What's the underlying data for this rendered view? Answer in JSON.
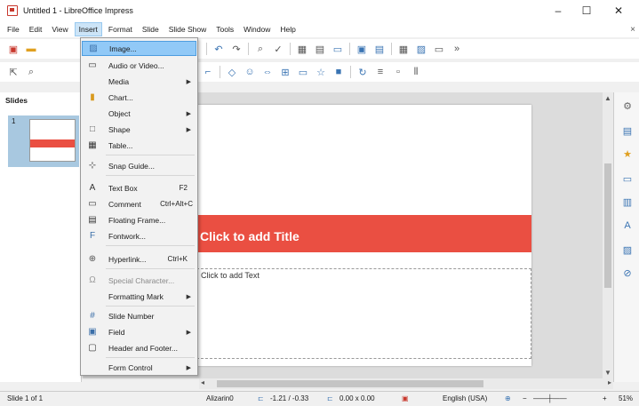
{
  "window": {
    "title": "Untitled 1 - LibreOffice Impress",
    "minimize": "–",
    "maximize": "☐",
    "close": "✕"
  },
  "menubar": {
    "items": [
      "File",
      "Edit",
      "View",
      "Insert",
      "Format",
      "Slide",
      "Slide Show",
      "Tools",
      "Window",
      "Help"
    ],
    "close_doc": "×"
  },
  "slides_panel": {
    "header": "Slides",
    "slide_number": "1"
  },
  "slide": {
    "title_placeholder": "Click to add Title",
    "text_placeholder": "Click to add Text"
  },
  "insert_menu": {
    "image": {
      "label": "Image...",
      "icon": "image-icon"
    },
    "audio_video": {
      "label": "Audio or Video...",
      "icon": "media-icon"
    },
    "media": {
      "label": "Media"
    },
    "chart": {
      "label": "Chart...",
      "icon": "chart-icon"
    },
    "object": {
      "label": "Object"
    },
    "shape": {
      "label": "Shape",
      "icon": "shape-icon"
    },
    "table": {
      "label": "Table...",
      "icon": "table-icon"
    },
    "snap_guide": {
      "label": "Snap Guide...",
      "icon": "snap-guide-icon"
    },
    "text_box": {
      "label": "Text Box",
      "shortcut": "F2",
      "icon": "text-box-icon"
    },
    "comment": {
      "label": "Comment",
      "shortcut": "Ctrl+Alt+C",
      "icon": "comment-icon"
    },
    "floating_frame": {
      "label": "Floating Frame...",
      "icon": "floating-frame-icon"
    },
    "fontwork": {
      "label": "Fontwork...",
      "icon": "fontwork-icon"
    },
    "hyperlink": {
      "label": "Hyperlink...",
      "shortcut": "Ctrl+K",
      "icon": "hyperlink-icon"
    },
    "special_character": {
      "label": "Special Character...",
      "icon": "omega-icon"
    },
    "formatting_mark": {
      "label": "Formatting Mark"
    },
    "slide_number": {
      "label": "Slide Number",
      "icon": "hash-icon"
    },
    "field": {
      "label": "Field",
      "icon": "field-icon"
    },
    "header_footer": {
      "label": "Header and Footer...",
      "icon": "header-footer-icon"
    },
    "form_control": {
      "label": "Form Control"
    }
  },
  "statusbar": {
    "slide_info": "Slide 1 of 1",
    "master": "Alizarin0",
    "position": "-1.21 / -0.33",
    "size": "0.00 x 0.00",
    "language": "English (USA)",
    "zoom": "51%"
  },
  "colors": {
    "accent": "#ea4f42",
    "menu_highlight": "#91c9f7"
  }
}
